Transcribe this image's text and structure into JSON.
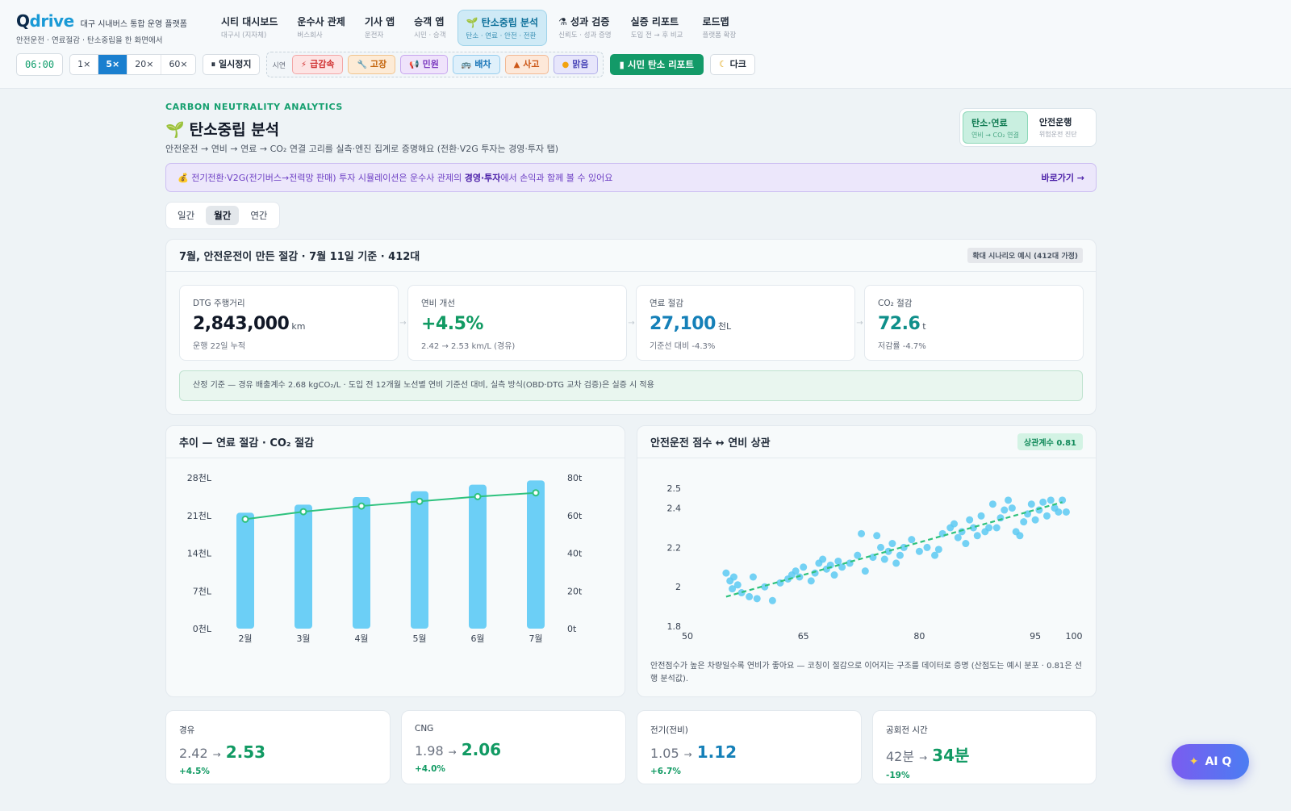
{
  "brand": {
    "logo_q": "Q",
    "logo_rest": "drive",
    "tagline": "대구 시내버스 통합 운영 플랫폼",
    "subtitle": "안전운전 · 연료절감 · 탄소중립을 한 화면에서"
  },
  "nav": [
    {
      "title": "시티 대시보드",
      "sub": "대구시 (지자체)",
      "active": false
    },
    {
      "title": "운수사 관제",
      "sub": "버스회사",
      "active": false
    },
    {
      "title": "기사 앱",
      "sub": "운전자",
      "active": false
    },
    {
      "title": "승객 앱",
      "sub": "시민 · 승객",
      "active": false
    },
    {
      "title": "탄소중립 분석",
      "sub": "탄소 · 연료 · 안전 · 전환",
      "icon": "seedling-icon",
      "active": true
    },
    {
      "title": "성과 검증",
      "sub": "신뢰도 · 성과 증명",
      "icon": "flask-icon",
      "active": false
    },
    {
      "title": "실증 리포트",
      "sub": "도입 전 → 후 비교",
      "active": false
    },
    {
      "title": "로드맵",
      "sub": "플랫폼 확장",
      "active": false
    }
  ],
  "controls": {
    "clock": "06:00",
    "speeds": [
      {
        "label": "1×",
        "active": false
      },
      {
        "label": "5×",
        "active": true
      },
      {
        "label": "20×",
        "active": false
      },
      {
        "label": "60×",
        "active": false
      }
    ],
    "pause_label": "일시정지",
    "scenario_label": "시연",
    "scenarios": [
      {
        "label": "급감속",
        "icon": "bolt-icon",
        "color": "red"
      },
      {
        "label": "고장",
        "icon": "wrench-icon",
        "color": "orange"
      },
      {
        "label": "민원",
        "icon": "megaphone-icon",
        "color": "purple"
      },
      {
        "label": "배차",
        "icon": "bus-icon",
        "color": "blue"
      },
      {
        "label": "사고",
        "icon": "warning-cone-icon",
        "color": "peach"
      },
      {
        "label": "맑음",
        "icon": "sun-icon",
        "color": "lav"
      }
    ],
    "report_label": "시민 탄소 리포트",
    "dark_label": "다크"
  },
  "page": {
    "kicker": "CARBON NEUTRALITY ANALYTICS",
    "title": "탄소중립 분석",
    "subtitle": "안전운전 → 연비 → 연료 → CO₂ 연결 고리를 실측·엔진 집계로 증명해요 (전환·V2G 투자는 경영·투자 탭)",
    "view_toggle": [
      {
        "title": "탄소·연료",
        "sub": "연비 → CO₂ 연결",
        "active": true
      },
      {
        "title": "안전운행",
        "sub": "위험운전 진단",
        "active": false
      }
    ],
    "notice": {
      "pre": "💰 전기전환·V2G(전기버스→전력망 판매) 투자 시뮬레이션은 운수사 관제의 ",
      "bold": "경영·투자",
      "post": "에서 손익과 함께 볼 수 있어요",
      "link": "바로가기 →"
    },
    "period_tabs": [
      {
        "label": "일간",
        "active": false
      },
      {
        "label": "월간",
        "active": true
      },
      {
        "label": "연간",
        "active": false
      }
    ]
  },
  "summary": {
    "title": "7월, 안전운전이 만든 절감 · 7월 11일 기준 · 412대",
    "tag": "확대 시나리오 예시 (412대 가정)",
    "kpis": [
      {
        "label": "DTG 주행거리",
        "value": "2,843,000",
        "unit": "km",
        "note": "운행 22일 누적",
        "color": "dark"
      },
      {
        "label": "연비 개선",
        "value": "+4.5%",
        "unit": "",
        "note": "2.42 → 2.53 km/L (경유)",
        "color": "green"
      },
      {
        "label": "연료 절감",
        "value": "27,100",
        "unit": "천L",
        "note": "기준선 대비 -4.3%",
        "color": "blue"
      },
      {
        "label": "CO₂ 절감",
        "value": "72.6",
        "unit": "t",
        "note": "저감률 -4.7%",
        "color": "teal"
      }
    ],
    "basis": "산정 기준 — 경유 배출계수 2.68 kgCO₂/L · 도입 전 12개월 노선별 연비 기준선 대비, 실측 방식(OBD·DTG 교차 검증)은 실증 시 적용"
  },
  "trend_title": "추이 — 연료 절감 · CO₂ 절감",
  "scatter_title": "안전운전 점수 ↔ 연비 상관",
  "scatter_tag": "상관계수 0.81",
  "scatter_note": "안전점수가 높은 차량일수록 연비가 좋아요 — 코칭이 절감으로 이어지는 구조를 데이터로 증명 (산점도는 예시 분포 · 0.81은 선행 분석값).",
  "chart_data": [
    {
      "type": "bar",
      "categories": [
        "2월",
        "3월",
        "4월",
        "5월",
        "6월",
        "7월"
      ],
      "series": [
        {
          "values": [
            21500,
            23000,
            24400,
            25500,
            26700,
            27500
          ],
          "kind": "bar",
          "axis": "left"
        },
        {
          "values": [
            58,
            62,
            65,
            67.5,
            70,
            72
          ],
          "kind": "line",
          "axis": "right"
        }
      ],
      "left_ticks": [
        "0천L",
        "7천L",
        "14천L",
        "21천L",
        "28천L"
      ],
      "right_ticks": [
        "0t",
        "20t",
        "40t",
        "60t",
        "80t"
      ],
      "ylim": [
        0,
        28000
      ],
      "y2lim": [
        0,
        80
      ],
      "colors": {
        "bar": "#6ccff6",
        "line": "#2ec27e"
      }
    },
    {
      "type": "scatter",
      "xlim": [
        50,
        100
      ],
      "ylim": [
        1.8,
        2.55
      ],
      "x_ticks": [
        50,
        65,
        80,
        95,
        100
      ],
      "y_ticks": [
        "1.8",
        "2",
        "2.2",
        "2.4",
        "2.5"
      ],
      "points": [
        [
          55,
          2.07
        ],
        [
          56,
          2.05
        ],
        [
          55.5,
          2.03
        ],
        [
          56.5,
          2.01
        ],
        [
          55.8,
          1.99
        ],
        [
          57,
          1.97
        ],
        [
          58,
          1.95
        ],
        [
          59,
          1.94
        ],
        [
          60,
          2.0
        ],
        [
          61,
          1.93
        ],
        [
          62,
          2.02
        ],
        [
          63,
          2.04
        ],
        [
          63.5,
          2.06
        ],
        [
          64,
          2.08
        ],
        [
          64.5,
          2.05
        ],
        [
          65,
          2.1
        ],
        [
          66,
          2.03
        ],
        [
          66.5,
          2.07
        ],
        [
          67,
          2.12
        ],
        [
          67.5,
          2.14
        ],
        [
          68,
          2.09
        ],
        [
          68.5,
          2.11
        ],
        [
          69,
          2.06
        ],
        [
          69.5,
          2.13
        ],
        [
          70,
          2.1
        ],
        [
          71,
          2.12
        ],
        [
          72,
          2.16
        ],
        [
          73,
          2.08
        ],
        [
          74,
          2.15
        ],
        [
          74.5,
          2.26
        ],
        [
          75,
          2.2
        ],
        [
          75.5,
          2.14
        ],
        [
          76,
          2.18
        ],
        [
          76.5,
          2.22
        ],
        [
          77,
          2.12
        ],
        [
          77.5,
          2.16
        ],
        [
          78,
          2.2
        ],
        [
          79,
          2.24
        ],
        [
          80,
          2.18
        ],
        [
          81,
          2.2
        ],
        [
          82,
          2.16
        ],
        [
          83,
          2.27
        ],
        [
          84,
          2.3
        ],
        [
          84.5,
          2.32
        ],
        [
          85,
          2.25
        ],
        [
          85.5,
          2.28
        ],
        [
          86,
          2.22
        ],
        [
          86.5,
          2.34
        ],
        [
          87,
          2.3
        ],
        [
          87.5,
          2.26
        ],
        [
          88,
          2.36
        ],
        [
          89,
          2.3
        ],
        [
          90,
          2.3
        ],
        [
          90.5,
          2.35
        ],
        [
          91,
          2.39
        ],
        [
          92,
          2.4
        ],
        [
          92.5,
          2.28
        ],
        [
          93,
          2.26
        ],
        [
          93.5,
          2.33
        ],
        [
          94,
          2.37
        ],
        [
          94.5,
          2.42
        ],
        [
          95,
          2.34
        ],
        [
          95.5,
          2.39
        ],
        [
          96,
          2.43
        ],
        [
          96.5,
          2.36
        ],
        [
          97,
          2.44
        ],
        [
          97.5,
          2.4
        ],
        [
          98,
          2.38
        ],
        [
          98.5,
          2.44
        ],
        [
          99,
          2.38
        ],
        [
          91.5,
          2.44
        ],
        [
          89.5,
          2.42
        ],
        [
          88.5,
          2.28
        ],
        [
          82.5,
          2.19
        ],
        [
          72.5,
          2.27
        ],
        [
          58.5,
          2.05
        ]
      ],
      "trend": [
        [
          55,
          1.95
        ],
        [
          98.5,
          2.43
        ]
      ],
      "colors": {
        "point": "#5cc9f2",
        "trend": "#2ec27e"
      }
    }
  ],
  "stats": [
    {
      "label": "경유",
      "before": "2.42",
      "after": "2.53",
      "delta": "+4.5%",
      "color": "green"
    },
    {
      "label": "CNG",
      "before": "1.98",
      "after": "2.06",
      "delta": "+4.0%",
      "color": "green"
    },
    {
      "label": "전기(전비)",
      "before": "1.05",
      "after": "1.12",
      "delta": "+6.7%",
      "color": "blue"
    },
    {
      "label": "공회전 시간",
      "before": "42분",
      "after": "34분",
      "delta": "-19%",
      "color": "green"
    }
  ],
  "aiq": {
    "label": "AI Q",
    "icon": "sparkle-icon"
  }
}
